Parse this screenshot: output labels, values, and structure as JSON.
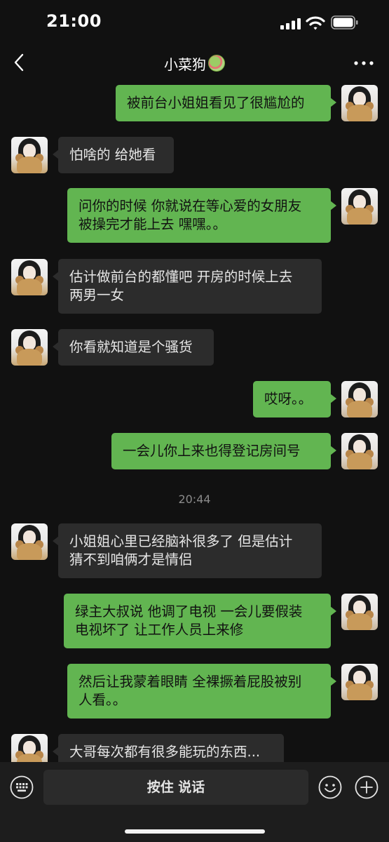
{
  "status": {
    "time": "21:00"
  },
  "nav": {
    "title": "小菜狗",
    "title_emoji": "salad-emoji-icon"
  },
  "messages": [
    {
      "side": "right",
      "text": "被前台小姐姐看见了很尴尬的"
    },
    {
      "side": "left",
      "text": "怕啥的 给她看"
    },
    {
      "side": "right",
      "lines": [
        "问你的时候 你就说在等心爱的女朋友",
        "被操完才能上去 嘿嘿。。"
      ]
    },
    {
      "side": "left",
      "lines": [
        "估计做前台的都懂吧 开房的时候上去",
        "两男一女"
      ]
    },
    {
      "side": "left",
      "text": "你看就知道是个骚货"
    },
    {
      "side": "right",
      "text": "哎呀。。"
    },
    {
      "side": "right",
      "text": "一会儿你上来也得登记房间号"
    },
    {
      "side": "left",
      "lines": [
        "小姐姐心里已经脑补很多了 但是估计",
        "猜不到咱俩才是情侣"
      ]
    },
    {
      "side": "right",
      "lines": [
        "绿主大叔说 他调了电视 一会儿要假装",
        "电视坏了 让工作人员上来修"
      ]
    },
    {
      "side": "right",
      "lines": [
        "然后让我蒙着眼睛 全裸撅着屁股被别",
        "人看。。"
      ]
    },
    {
      "side": "left",
      "text": "大哥每次都有很多能玩的东西..."
    }
  ],
  "timestamp": "20:44",
  "input": {
    "hold_to_talk": "按住 说话"
  },
  "colors": {
    "outgoing_bubble": "#62b551",
    "incoming_bubble": "#2c2c2c",
    "background": "#111111"
  }
}
